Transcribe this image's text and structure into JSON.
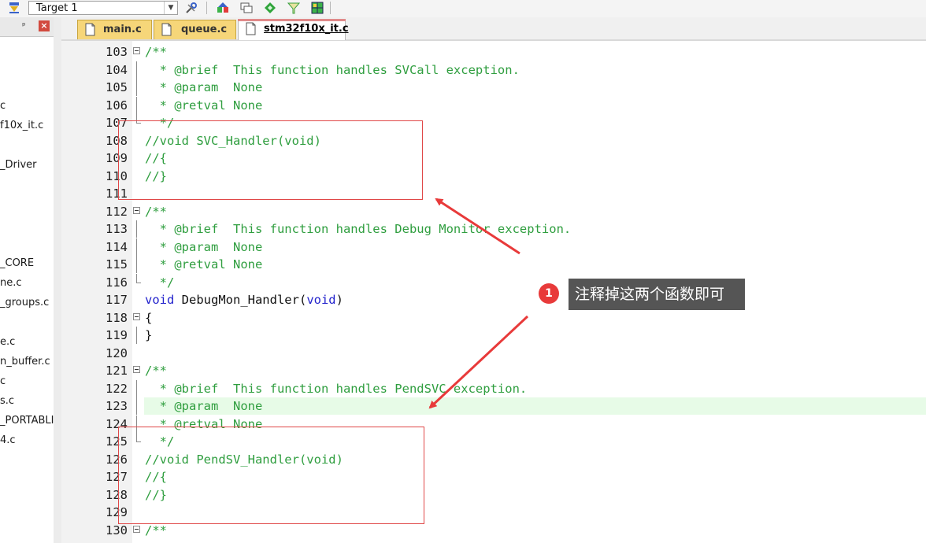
{
  "toolbar": {
    "target_label": "Target 1",
    "icons": [
      "download-icon",
      "options-icon",
      "manage-components-icon",
      "window-layout-icon",
      "diamond-icon",
      "filter-icon",
      "grid-icon"
    ]
  },
  "project_panel": {
    "items": [
      "c",
      "f10x_it.c",
      "_Driver",
      "_CORE",
      "ne.c",
      "_groups.c",
      "e.c",
      "n_buffer.c",
      "c",
      "s.c",
      "_PORTABLI",
      "4.c"
    ]
  },
  "tabs": [
    {
      "label": "main.c",
      "active": false
    },
    {
      "label": "queue.c",
      "active": false
    },
    {
      "label": "stm32f10x_it.c",
      "active": true
    }
  ],
  "code_lines": [
    {
      "num": "103",
      "text": "/**"
    },
    {
      "num": "104",
      "text": "  * @brief  This function handles SVCall exception."
    },
    {
      "num": "105",
      "text": "  * @param  None"
    },
    {
      "num": "106",
      "text": "  * @retval None"
    },
    {
      "num": "107",
      "text": "  */"
    },
    {
      "num": "108",
      "text": "//void SVC_Handler(void)"
    },
    {
      "num": "109",
      "text": "//{"
    },
    {
      "num": "110",
      "text": "//}"
    },
    {
      "num": "111",
      "text": ""
    },
    {
      "num": "112",
      "text": "/**"
    },
    {
      "num": "113",
      "text": "  * @brief  This function handles Debug Monitor exception."
    },
    {
      "num": "114",
      "text": "  * @param  None"
    },
    {
      "num": "115",
      "text": "  * @retval None"
    },
    {
      "num": "116",
      "text": "  */"
    },
    {
      "num": "117",
      "kw1": "void",
      "mid": " DebugMon_Handler(",
      "kw2": "void",
      "end": ")"
    },
    {
      "num": "118",
      "text": "{"
    },
    {
      "num": "119",
      "text": "}"
    },
    {
      "num": "120",
      "text": ""
    },
    {
      "num": "121",
      "text": "/**"
    },
    {
      "num": "122",
      "text": "  * @brief  This function handles PendSVC exception."
    },
    {
      "num": "123",
      "text": "  * @param  None"
    },
    {
      "num": "124",
      "text": "  * @retval None"
    },
    {
      "num": "125",
      "text": "  */"
    },
    {
      "num": "126",
      "text": "//void PendSV_Handler(void)"
    },
    {
      "num": "127",
      "text": "//{"
    },
    {
      "num": "128",
      "text": "//}"
    },
    {
      "num": "129",
      "text": ""
    },
    {
      "num": "130",
      "text": "/**"
    }
  ],
  "callout": {
    "badge": "1",
    "text": "注释掉这两个函数即可"
  },
  "colors": {
    "comment": "#2f9e3f",
    "keyword": "#2222cc",
    "highlight_line": "#e7fbe7",
    "annotation_red": "#e04848",
    "callout_bg": "#555555",
    "tab_inactive": "#f6d679"
  }
}
